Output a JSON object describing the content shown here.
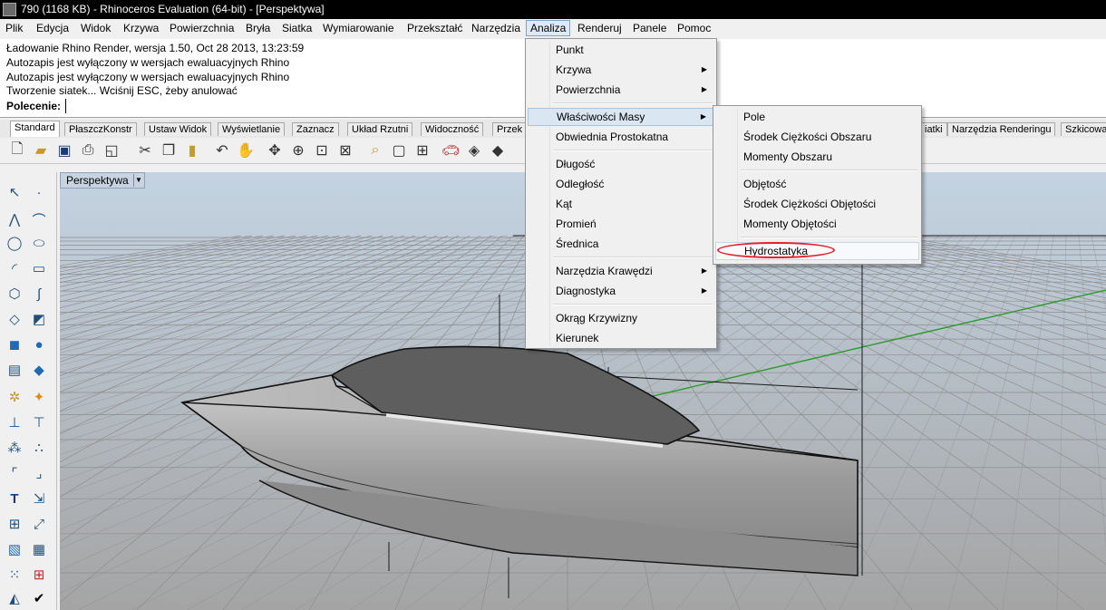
{
  "window": {
    "title": "790 (1168 KB) - Rhinoceros Evaluation (64-bit) - [Perspektywa]"
  },
  "menubar": {
    "items": [
      "Plik",
      "Edycja",
      "Widok",
      "Krzywa",
      "Powierzchnia",
      "Bryła",
      "Siatka",
      "Wymiarowanie",
      "Przekształć",
      "Narzędzia",
      "Analiza",
      "Renderuj",
      "Panele",
      "Pomoc"
    ],
    "active": "Analiza"
  },
  "history": {
    "lines": [
      "Ładowanie Rhino Render, wersja 1.50, Oct 28 2013, 13:23:59",
      "Autozapis jest wyłączony w wersjach ewaluacyjnych Rhino",
      "Autozapis jest wyłączony w wersjach ewaluacyjnych Rhino",
      "Tworzenie siatek... Wciśnij ESC, żeby anulować"
    ]
  },
  "command": {
    "label": "Polecenie:",
    "value": ""
  },
  "tabs": {
    "left": [
      "Standard",
      "PłaszczKonstr",
      "Ustaw Widok",
      "Wyświetlanie",
      "Zaznacz",
      "Układ Rzutni",
      "Widoczność",
      "Przek"
    ],
    "right": [
      "iatki",
      "Narzędzia Renderingu",
      "Szkicowa"
    ],
    "active": "Standard"
  },
  "viewport": {
    "label": "Perspektywa",
    "bg_top": "#c4d3e2",
    "bg_bottom": "#a4a4a4"
  },
  "analiza_menu": {
    "items": [
      "Punkt",
      "Krzywa",
      "Powierzchnia",
      "Właściwości Masy",
      "Obwiednia Prostokatna",
      "Długość",
      "Odległość",
      "Kąt",
      "Promień",
      "Średnica",
      "Narzędzia Krawędzi",
      "Diagnostyka",
      "Okrąg Krzywizny",
      "Kierunek"
    ]
  },
  "masy_menu": {
    "items": [
      "Pole",
      "Środek Ciężkości Obszaru",
      "Momenty Obszaru",
      "Objętość",
      "Środek Ciężkości Objętości",
      "Momenty Objętości",
      "Hydrostatyka"
    ],
    "highlight_color": "#e8202a"
  }
}
